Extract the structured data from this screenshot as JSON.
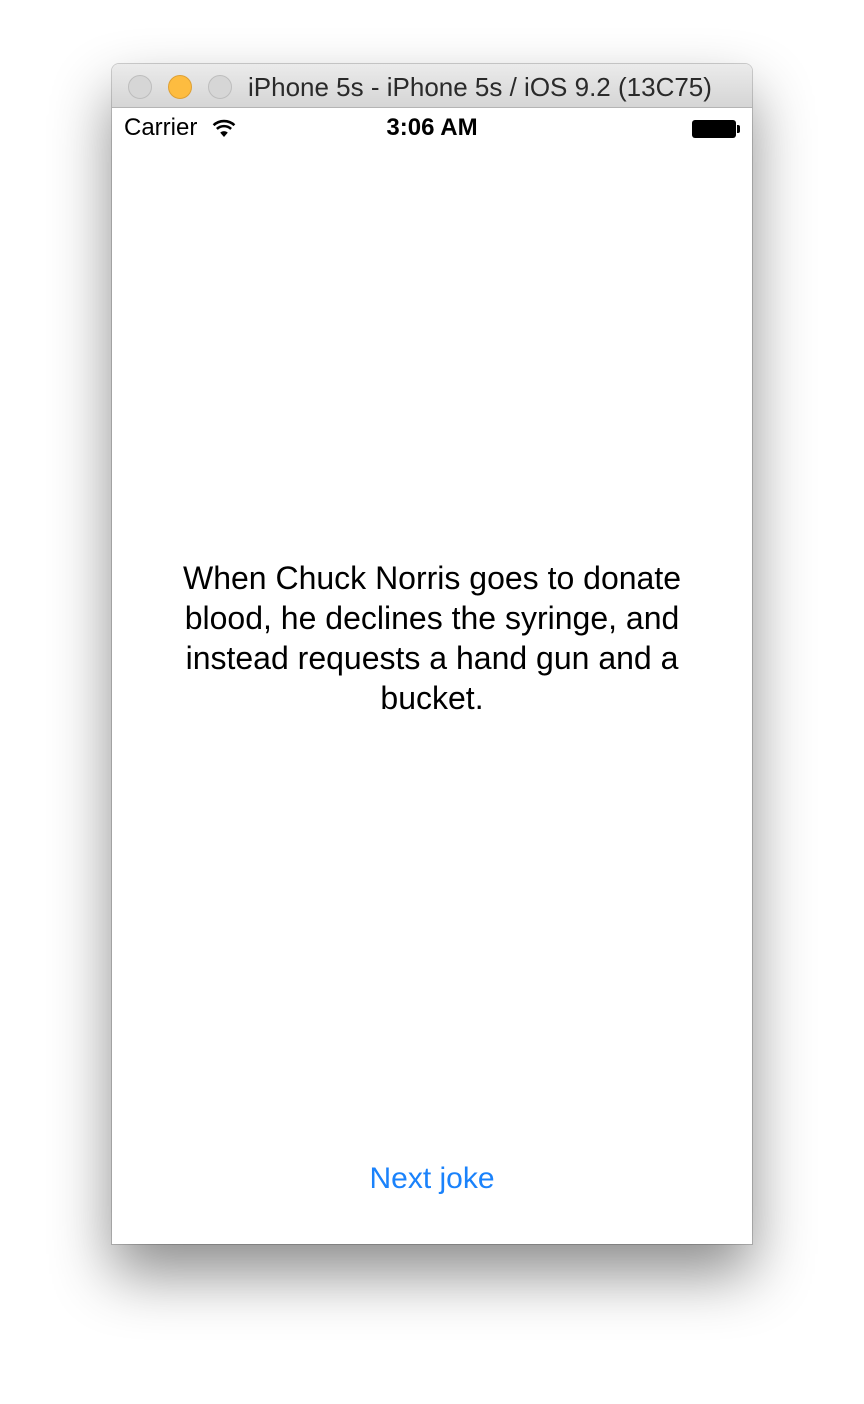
{
  "window": {
    "title": "iPhone 5s - iPhone 5s / iOS 9.2 (13C75)"
  },
  "status_bar": {
    "carrier": "Carrier",
    "time": "3:06 AM",
    "wifi_icon": "wifi-icon",
    "battery_icon": "battery-icon"
  },
  "main": {
    "joke_text": "When Chuck Norris goes to donate blood, he declines the syringe, and instead requests a hand gun and a bucket.",
    "next_button_label": "Next joke"
  },
  "colors": {
    "accent": "#1a82fb",
    "minimize_button": "#fdbc40"
  }
}
